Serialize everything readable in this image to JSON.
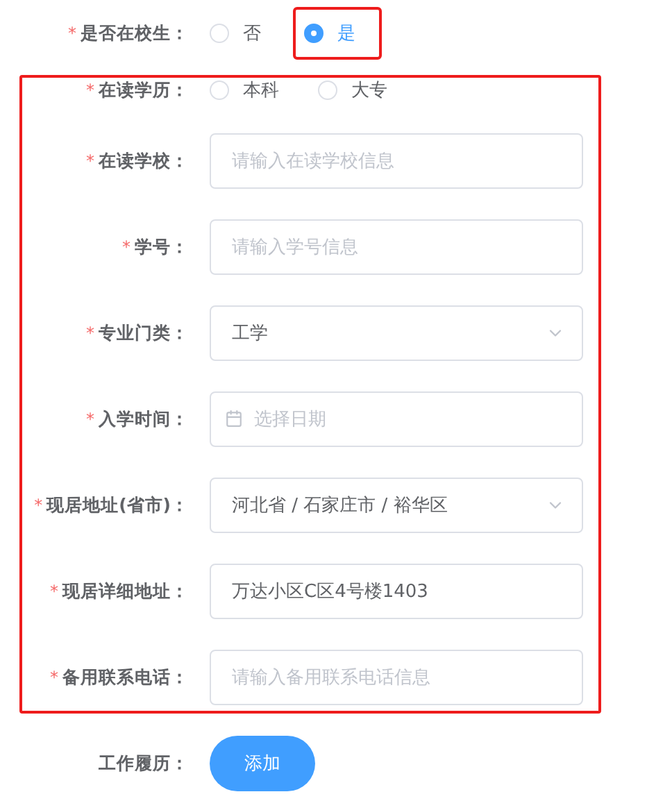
{
  "top_field": {
    "kind": "radio",
    "label": "是否在校生：",
    "required_mark": "*",
    "options": [
      {
        "label": "否",
        "selected": false,
        "highlighted": false
      },
      {
        "label": "是",
        "selected": true,
        "highlighted": true
      }
    ]
  },
  "section": {
    "highlighted": true,
    "fields": [
      {
        "kind": "radio",
        "label": "在读学历：",
        "required_mark": "*",
        "options": [
          {
            "label": "本科",
            "selected": false,
            "highlighted": false
          },
          {
            "label": "大专",
            "selected": false,
            "highlighted": false
          }
        ]
      },
      {
        "kind": "input",
        "label": "在读学校：",
        "required_mark": "*",
        "placeholder": "请输入在读学校信息"
      },
      {
        "kind": "input",
        "label": "学号：",
        "required_mark": "*",
        "placeholder": "请输入学号信息"
      },
      {
        "kind": "select",
        "label": "专业门类：",
        "required_mark": "*",
        "value": "工学"
      },
      {
        "kind": "date",
        "label": "入学时间：",
        "required_mark": "*",
        "placeholder": "选择日期"
      },
      {
        "kind": "select",
        "label": "现居地址(省市)：",
        "required_mark": "*",
        "value": "河北省 / 石家庄市 / 裕华区"
      },
      {
        "kind": "input",
        "label": "现居详细地址：",
        "required_mark": "*",
        "value": "万达小区C区4号楼1403"
      },
      {
        "kind": "input",
        "label": "备用联系电话：",
        "required_mark": "*",
        "placeholder": "请输入备用联系电话信息"
      }
    ]
  },
  "footer": {
    "label": "工作履历：",
    "button": "添加"
  }
}
